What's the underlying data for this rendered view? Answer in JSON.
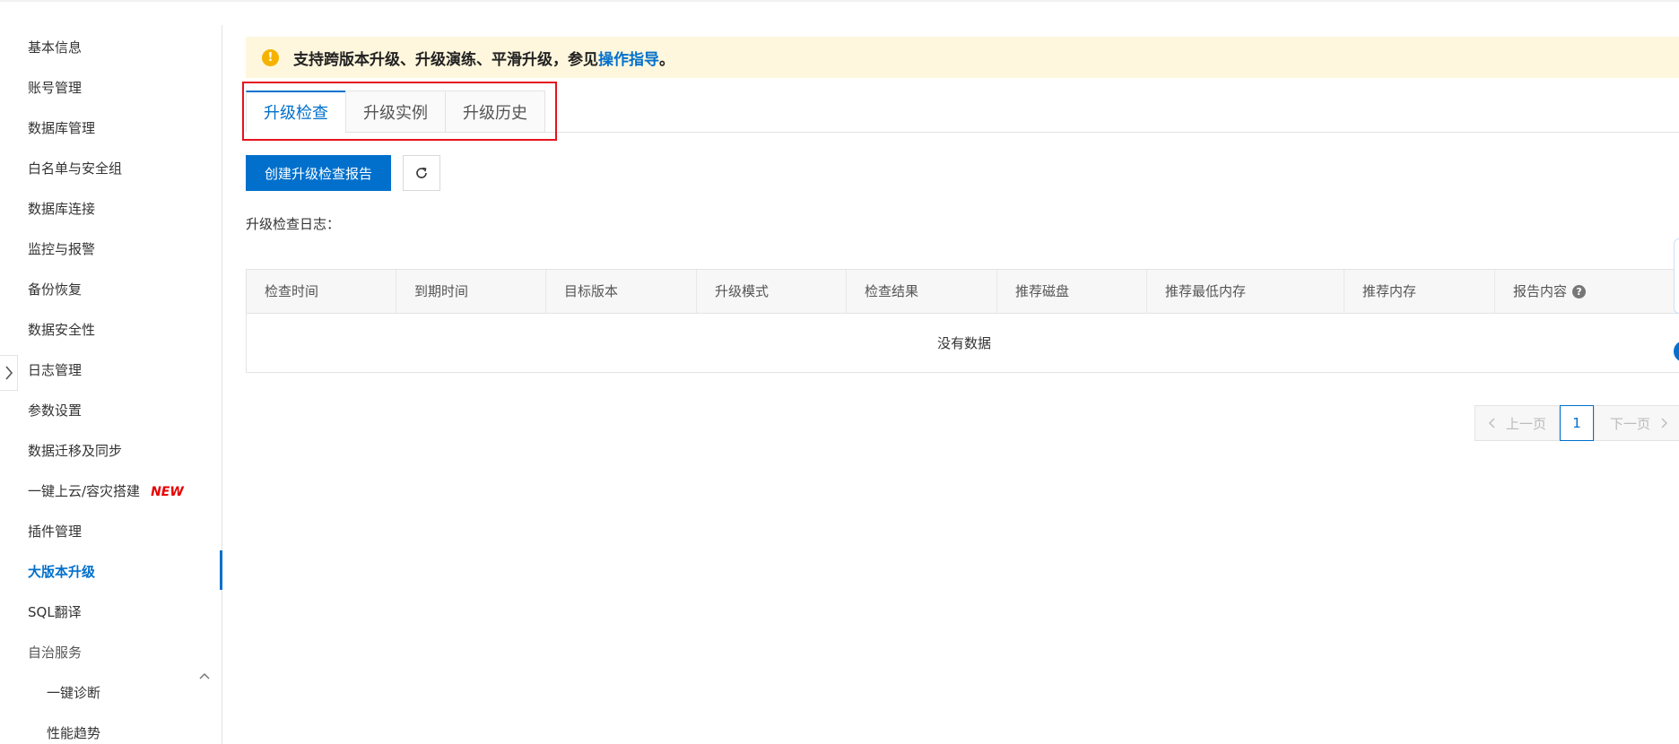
{
  "sidebar": {
    "items": [
      {
        "label": "基本信息"
      },
      {
        "label": "账号管理"
      },
      {
        "label": "数据库管理"
      },
      {
        "label": "白名单与安全组"
      },
      {
        "label": "数据库连接"
      },
      {
        "label": "监控与报警"
      },
      {
        "label": "备份恢复"
      },
      {
        "label": "数据安全性"
      },
      {
        "label": "日志管理"
      },
      {
        "label": "参数设置"
      },
      {
        "label": "数据迁移及同步"
      },
      {
        "label": "一键上云/容灾搭建",
        "badge": "NEW"
      },
      {
        "label": "插件管理"
      },
      {
        "label": "大版本升级",
        "active": true
      },
      {
        "label": "SQL翻译"
      },
      {
        "label": "自治服务",
        "expanded": true
      },
      {
        "label": "一键诊断"
      },
      {
        "label": "性能趋势"
      }
    ]
  },
  "notice": {
    "text": "支持跨版本升级、升级演练、平滑升级，参见",
    "link": "操作指导",
    "end": "。",
    "color": "#fff7dd"
  },
  "tabs": [
    {
      "label": "升级检查",
      "active": true
    },
    {
      "label": "升级实例"
    },
    {
      "label": "升级历史"
    }
  ],
  "toolbar": {
    "create_label": "创建升级检查报告",
    "refresh_icon": "refresh-icon"
  },
  "log_label": "升级检查日志：",
  "table": {
    "columns": [
      "检查时间",
      "到期时间",
      "目标版本",
      "升级模式",
      "检查结果",
      "推荐磁盘",
      "推荐最低内存",
      "推荐内存",
      "报告内容"
    ],
    "empty_text": "没有数据"
  },
  "pagination": {
    "prev": "上一页",
    "page": "1",
    "next": "下一页"
  },
  "colors": {
    "accent": "#0070cc",
    "highlight": "#e5131d",
    "warning": "#f5b300"
  }
}
